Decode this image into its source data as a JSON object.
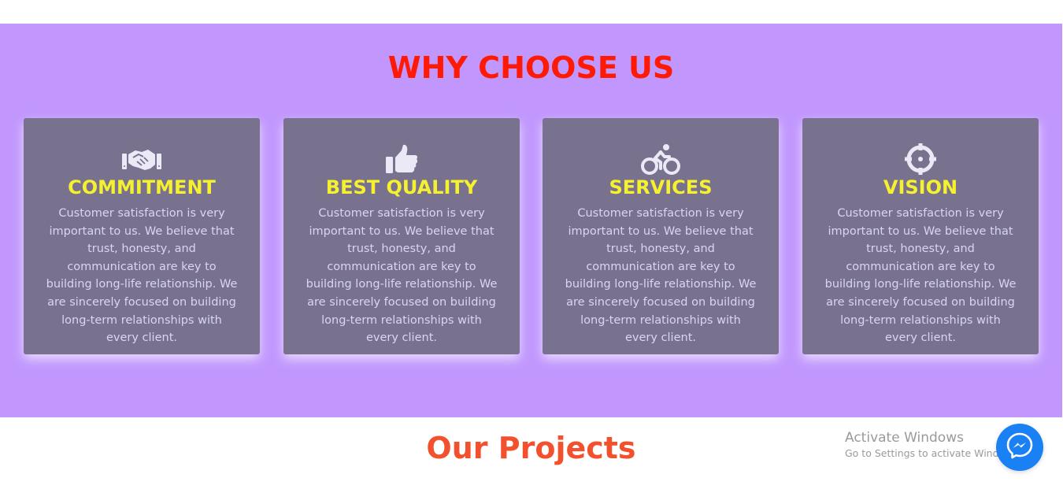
{
  "why_section": {
    "title": "WHY CHOOSE US",
    "background": "#c197fd",
    "title_color": "#ff1a05",
    "cards": [
      {
        "icon": "handshake-icon",
        "title": "COMMITMENT",
        "text": "Customer satisfaction is very important to us. We believe that trust, honesty, and communication are key to building long-life relationship. We are sincerely focused on building long-term relationships with every client."
      },
      {
        "icon": "thumbs-up-icon",
        "title": "BEST QUALITY",
        "text": "Customer satisfaction is very important to us. We believe that trust, honesty, and communication are key to building long-life relationship. We are sincerely focused on building long-term relationships with every client."
      },
      {
        "icon": "bicycle-icon",
        "title": "SERVICES",
        "text": "Customer satisfaction is very important to us. We believe that trust, honesty, and communication are key to building long-life relationship. We are sincerely focused on building long-term relationships with every client."
      },
      {
        "icon": "crosshairs-icon",
        "title": "VISION",
        "text": "Customer satisfaction is very important to us. We believe that trust, honesty, and communication are key to building long-life relationship. We are sincerely focused on building long-term relationships with every client."
      }
    ],
    "card_color": "#78728e",
    "card_title_color": "#f6f12f"
  },
  "projects": {
    "title": "Our Projects",
    "title_color": "#f3512d"
  },
  "activate_windows": {
    "title": "Activate Windows",
    "subtitle": "Go to Settings to activate Windows."
  },
  "chat_widget": {
    "icon": "messenger-icon",
    "color": "#1a81f5"
  }
}
